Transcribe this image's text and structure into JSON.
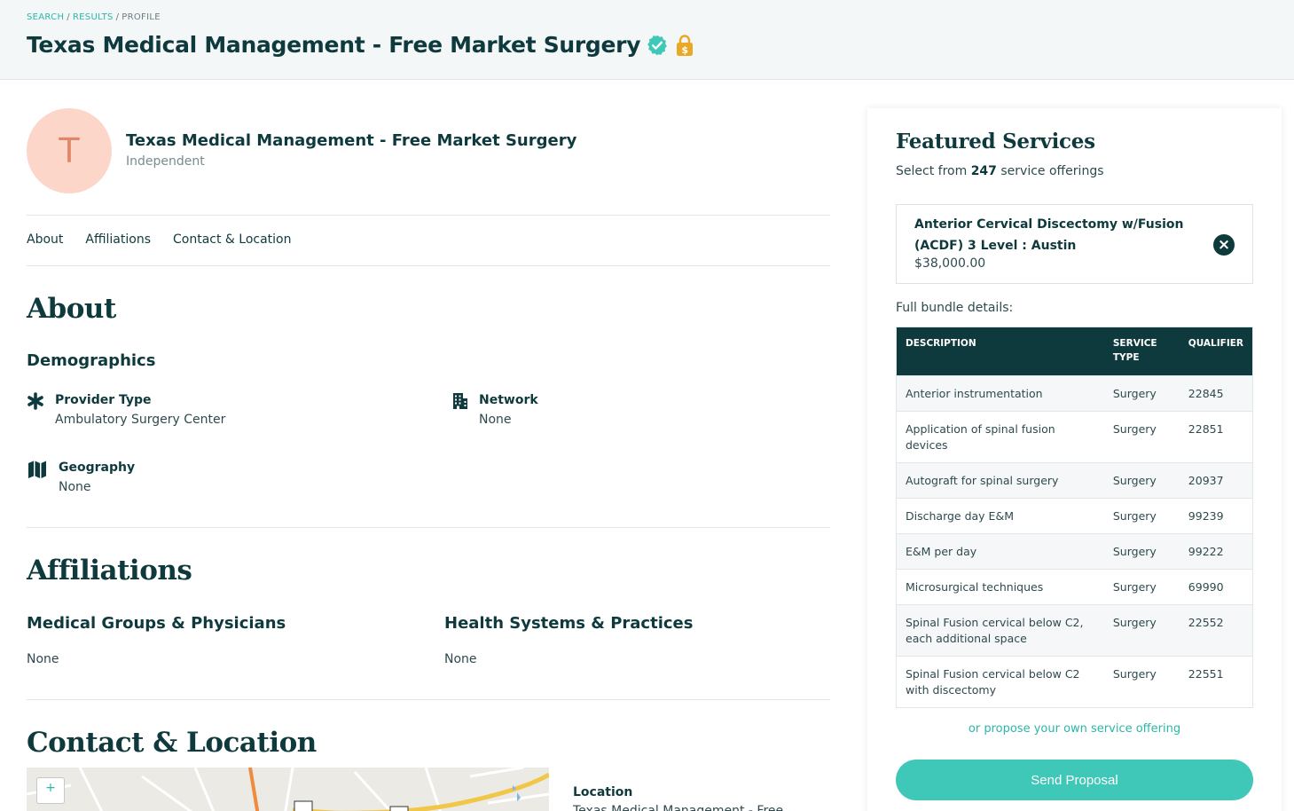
{
  "breadcrumb": {
    "search": "SEARCH",
    "results": "RESULTS",
    "current": "PROFILE",
    "sep": "/"
  },
  "page_title": "Texas Medical Management - Free Market Surgery",
  "provider": {
    "initial": "T",
    "name": "Texas Medical Management - Free Market Surgery",
    "type_label": "Independent"
  },
  "tabs": [
    "About",
    "Affiliations",
    "Contact & Location"
  ],
  "about": {
    "heading": "About",
    "demographics_heading": "Demographics",
    "provider_type_label": "Provider Type",
    "provider_type_value": "Ambulatory Surgery Center",
    "network_label": "Network",
    "network_value": "None",
    "geography_label": "Geography",
    "geography_value": "None"
  },
  "affiliations": {
    "heading": "Affiliations",
    "groups_heading": "Medical Groups & Physicians",
    "groups_value": "None",
    "systems_heading": "Health Systems & Practices",
    "systems_value": "None"
  },
  "contact": {
    "heading": "Contact & Location",
    "zoom_in": "+",
    "location_label": "Location",
    "location_value": "Texas Medical Management - Free"
  },
  "featured": {
    "title": "Featured Services",
    "sub_prefix": "Select from",
    "count": "247",
    "sub_suffix": "service offerings",
    "selected_name": "Anterior Cervical Discectomy w/Fusion (ACDF) 3 Level : Austin",
    "selected_price": "$38,000.00",
    "close_icon": "×",
    "bundle_label": "Full bundle details:",
    "columns": [
      "DESCRIPTION",
      "SERVICE TYPE",
      "QUALIFIER"
    ],
    "rows": [
      [
        "Anterior instrumentation",
        "Surgery",
        "22845"
      ],
      [
        "Application of spinal fusion devices",
        "Surgery",
        "22851"
      ],
      [
        "Autograft for spinal surgery",
        "Surgery",
        "20937"
      ],
      [
        "Discharge day E&M",
        "Surgery",
        "99239"
      ],
      [
        "E&M per day",
        "Surgery",
        "99222"
      ],
      [
        "Microsurgical techniques",
        "Surgery",
        "69990"
      ],
      [
        "Spinal Fusion cervical below C2, each additional space",
        "Surgery",
        "22552"
      ],
      [
        "Spinal Fusion cervical below C2 with discectomy",
        "Surgery",
        "22551"
      ]
    ],
    "propose_link": "or propose your own service offering",
    "send_button": "Send Proposal"
  },
  "colors": {
    "primary": "#0f3a3d",
    "accent": "#3fc7b7",
    "link": "#2bb6a8",
    "avatar_bg": "#fcd6c8",
    "lock": "#e9a826"
  }
}
